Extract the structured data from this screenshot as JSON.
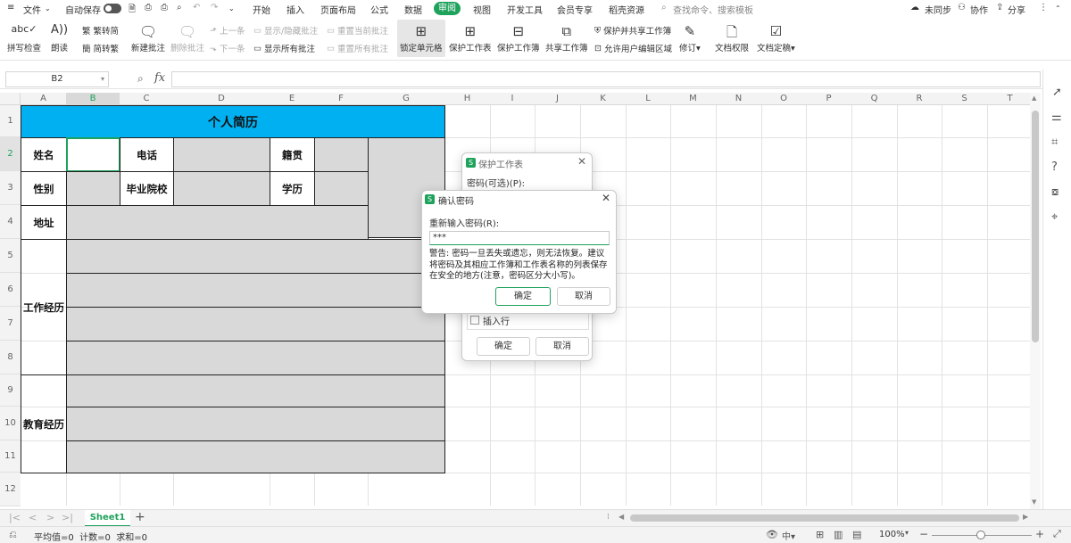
{
  "menubar": {
    "file": "文件",
    "autosave": "自动保存",
    "tabs": [
      "开始",
      "插入",
      "页面布局",
      "公式",
      "数据",
      "审阅",
      "视图",
      "开发工具",
      "会员专享",
      "稻壳资源"
    ],
    "active_tab": "审阅",
    "search_placeholder": "查找命令、搜索模板",
    "sync": "未同步",
    "collab": "协作",
    "share": "分享"
  },
  "ribbon": {
    "spellcheck": "拼写检查",
    "read": "朗读",
    "trad_to_simp": "繁转简",
    "simp_to_trad": "简转繁",
    "new_comment": "新建批注",
    "delete_comment": "删除批注",
    "prev": "上一条",
    "next": "下一条",
    "show_hide_comment": "显示/隐藏批注",
    "show_all_comments": "显示所有批注",
    "reset_current_comment": "重置当前批注",
    "reset_all_comments": "重置所有批注",
    "lock_cell": "锁定单元格",
    "protect_sheet": "保护工作表",
    "protect_workbook": "保护工作簿",
    "share_workbook": "共享工作簿",
    "protect_share_workbook": "保护并共享工作簿",
    "allow_edit_ranges": "允许用户编辑区域",
    "revise": "修订",
    "doc_permission": "文档权限",
    "doc_finalize": "文档定稿"
  },
  "formula_bar": {
    "cell_ref": "B2",
    "fx": "fx",
    "value": ""
  },
  "columns": [
    "A",
    "B",
    "C",
    "D",
    "E",
    "F",
    "G",
    "H",
    "I",
    "J",
    "K",
    "L",
    "M",
    "N",
    "O",
    "P",
    "Q",
    "R",
    "S",
    "T"
  ],
  "rows": [
    "1",
    "2",
    "3",
    "4",
    "5",
    "6",
    "7",
    "8",
    "9",
    "10",
    "11",
    "12"
  ],
  "sheet": {
    "title": "个人简历",
    "name_label": "姓名",
    "phone_label": "电话",
    "origin_label": "籍贯",
    "gender_label": "性别",
    "school_label": "毕业院校",
    "degree_label": "学历",
    "address_label": "地址",
    "work_label": "工作经历",
    "edu_label": "教育经历"
  },
  "protect_dialog": {
    "title": "保护工作表",
    "password_label": "密码(可选)(P):",
    "insert_row": "插入行",
    "ok": "确定",
    "cancel": "取消"
  },
  "confirm_dialog": {
    "title": "确认密码",
    "reenter_label": "重新输入密码(R):",
    "password_value": "***",
    "warning": "警告: 密码一旦丢失或遗忘，则无法恢复。建议将密码及其相应工作簿和工作表名称的列表保存在安全的地方(注意，密码区分大小写)。",
    "ok": "确定",
    "cancel": "取消"
  },
  "sheet_tabs": {
    "active": "Sheet1"
  },
  "status": {
    "summary": "平均值=0  计数=0  求和=0",
    "zoom": "100%"
  },
  "colors": {
    "accent": "#1fa25c",
    "title_fill": "#00b0f0",
    "gray_fill": "#d9d9d9"
  }
}
